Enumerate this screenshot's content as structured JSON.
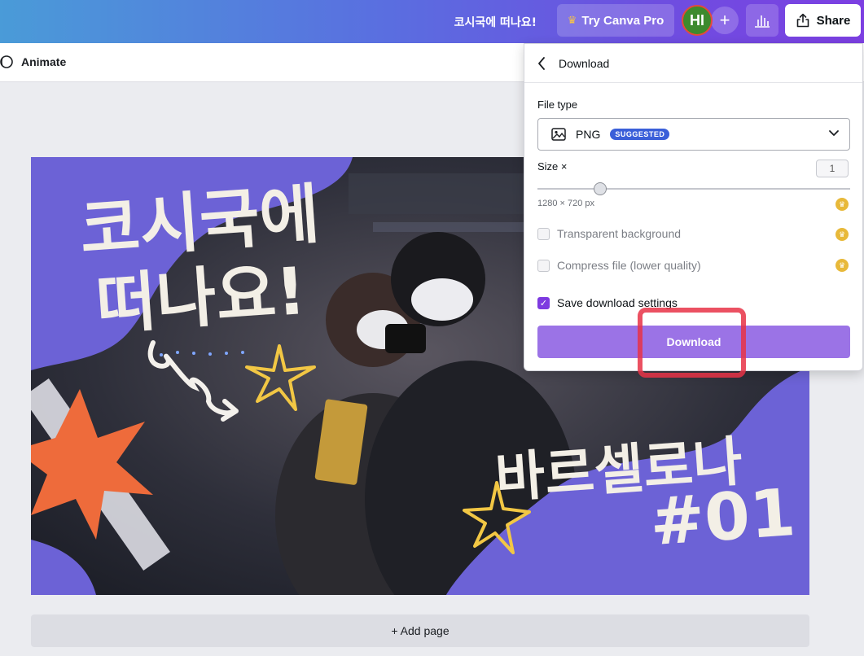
{
  "topbar": {
    "doc_title": "코시국에 떠나요!",
    "pro_label": "Try Canva Pro",
    "avatar_initials": "HI",
    "plus": "+",
    "share_label": "Share"
  },
  "toolbar": {
    "animate_label": "Animate"
  },
  "canvas": {
    "headline_1": "코시국에",
    "headline_2": "떠나요!",
    "city": "바르셀로나",
    "episode": "#01"
  },
  "add_page_label": "+ Add page",
  "download_panel": {
    "title": "Download",
    "file_type_label": "File type",
    "file_type_value": "PNG",
    "suggested_badge": "SUGGESTED",
    "size_label": "Size ×",
    "size_value": "1",
    "size_fraction": 0.2,
    "dimensions": "1280 × 720 px",
    "options": [
      {
        "label": "Transparent background",
        "checked": false,
        "pro": true
      },
      {
        "label": "Compress file (lower quality)",
        "checked": false,
        "pro": true
      },
      {
        "label": "Save download settings",
        "checked": true,
        "pro": false
      }
    ],
    "download_button": "Download"
  },
  "colors": {
    "accent_purple": "#7d3ae0",
    "download_button": "#9b73e6",
    "badge_blue": "#3a5fd9",
    "canvas_purple": "#6c62d6",
    "star_orange": "#ee6b3b",
    "star_yellow": "#f2c744"
  }
}
